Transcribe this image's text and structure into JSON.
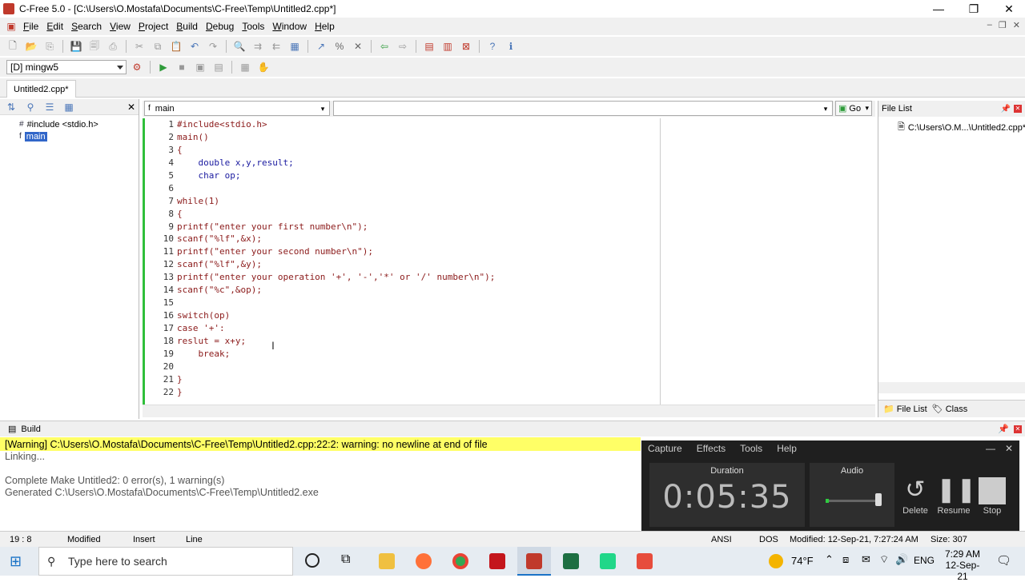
{
  "window": {
    "title": "C-Free 5.0 - [C:\\Users\\O.Mostafa\\Documents\\C-Free\\Temp\\Untitled2.cpp*]"
  },
  "menu": [
    "File",
    "Edit",
    "Search",
    "View",
    "Project",
    "Build",
    "Debug",
    "Tools",
    "Window",
    "Help"
  ],
  "compiler": "[D] mingw5",
  "doc_tab": "Untitled2.cpp*",
  "outline": {
    "include": "#include <stdio.h>",
    "func": "main"
  },
  "function_combo": "main",
  "go_label": "Go",
  "code_lines": [
    "#include<stdio.h>",
    "main()",
    "{",
    "    double x,y,result;",
    "    char op;",
    "",
    "while(1)",
    "{",
    "printf(\"enter your first number\\n\");",
    "scanf(\"%lf\",&x);",
    "printf(\"enter your second number\\n\");",
    "scanf(\"%lf\",&y);",
    "printf(\"enter your operation '+', '-','*' or '/' number\\n\");",
    "scanf(\"%c\",&op);",
    "",
    "switch(op)",
    "case '+':",
    "reslut = x+y;",
    "    break;",
    "",
    "}",
    "}"
  ],
  "file_list": {
    "title": "File List",
    "item": "C:\\Users\\O.M...\\Untitled2.cpp*",
    "tab1": "File List",
    "tab2": "Class"
  },
  "build": {
    "title": "Build",
    "warning": "[Warning] C:\\Users\\O.Mostafa\\Documents\\C-Free\\Temp\\Untitled2.cpp:22:2: warning: no newline at end of file",
    "lines": [
      "Linking...",
      "",
      "Complete Make Untitled2: 0 error(s), 1 warning(s)",
      "Generated C:\\Users\\O.Mostafa\\Documents\\C-Free\\Temp\\Untitled2.exe"
    ]
  },
  "status": {
    "pos": "19 : 8",
    "modified": "Modified",
    "insert": "Insert",
    "line": "Line",
    "enc": "ANSI",
    "eol": "DOS",
    "mtime": "Modified: 12-Sep-21, 7:27:24 AM",
    "size": "Size: 307"
  },
  "recorder": {
    "menu": [
      "Capture",
      "Effects",
      "Tools",
      "Help"
    ],
    "duration_label": "Duration",
    "duration": "0:05:35",
    "audio_label": "Audio",
    "delete": "Delete",
    "resume": "Resume",
    "stop": "Stop"
  },
  "taskbar": {
    "search": "Type here to search",
    "temp": "74°F",
    "lang": "ENG",
    "time": "7:29 AM",
    "date": "12-Sep-21"
  }
}
